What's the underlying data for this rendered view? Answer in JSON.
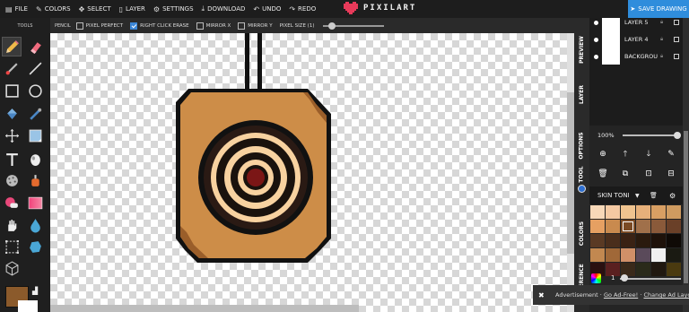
{
  "menu": {
    "file": "FILE",
    "colors": "COLORS",
    "select": "SELECT",
    "layer": "LAYER",
    "settings": "SETTINGS",
    "download": "DOWNLOAD",
    "undo": "UNDO",
    "redo": "REDO"
  },
  "app_name": "PIXILART",
  "save_label": "SAVE DRAWING",
  "options": {
    "label": "PENCIL",
    "pixel_perfect": "PIXEL PERFECT",
    "right_click_erase": "RIGHT CLICK ERASE",
    "mirror_x": "MIRROR X",
    "mirror_y": "MIRROR Y",
    "pixel_size": "PIXEL SIZE (1)"
  },
  "tools_title": "TOOLS",
  "tabs": {
    "preview": "PREVIEW",
    "layer": "LAYER",
    "options": "OPTIONS",
    "tool": "TOOL",
    "colors": "COLORS",
    "reference": "EFERENCE"
  },
  "layers": [
    {
      "name": "LAYER 5"
    },
    {
      "name": "LAYER 4"
    },
    {
      "name": "BACKGROU"
    }
  ],
  "opacity": "100%",
  "palette": {
    "name": "SKIN TONI",
    "swatches": [
      "#f7d8b8",
      "#f4c9a2",
      "#efc38f",
      "#e6b07a",
      "#d89f63",
      "#cf9b60",
      "#e6a062",
      "#c98a4e",
      "#7a4a24",
      "#a0704a",
      "#8a5a3a",
      "#6a4028",
      "#5a3a24",
      "#4a2e1c",
      "#3a2214",
      "#2a1a0e",
      "#1e120a",
      "#0f0a06",
      "#c28850",
      "#a06838",
      "#d09068",
      "#5a4a5a",
      "#f0f0f0",
      "#1a1a12",
      "#2a1010",
      "#5a2020",
      "#3a2a1a",
      "#2a2a1a",
      "#201810",
      "#4a3a10"
    ],
    "selected_index": 8,
    "brush_size": "1"
  },
  "ad": {
    "text": "Advertisement ·",
    "link1": "Go Ad-Free!",
    "sep": "·",
    "link2": "Change Ad Layout"
  },
  "colors": {
    "primary": "#8b5a2b",
    "secondary": "#ffffff",
    "accent": "#2f8ddc"
  }
}
